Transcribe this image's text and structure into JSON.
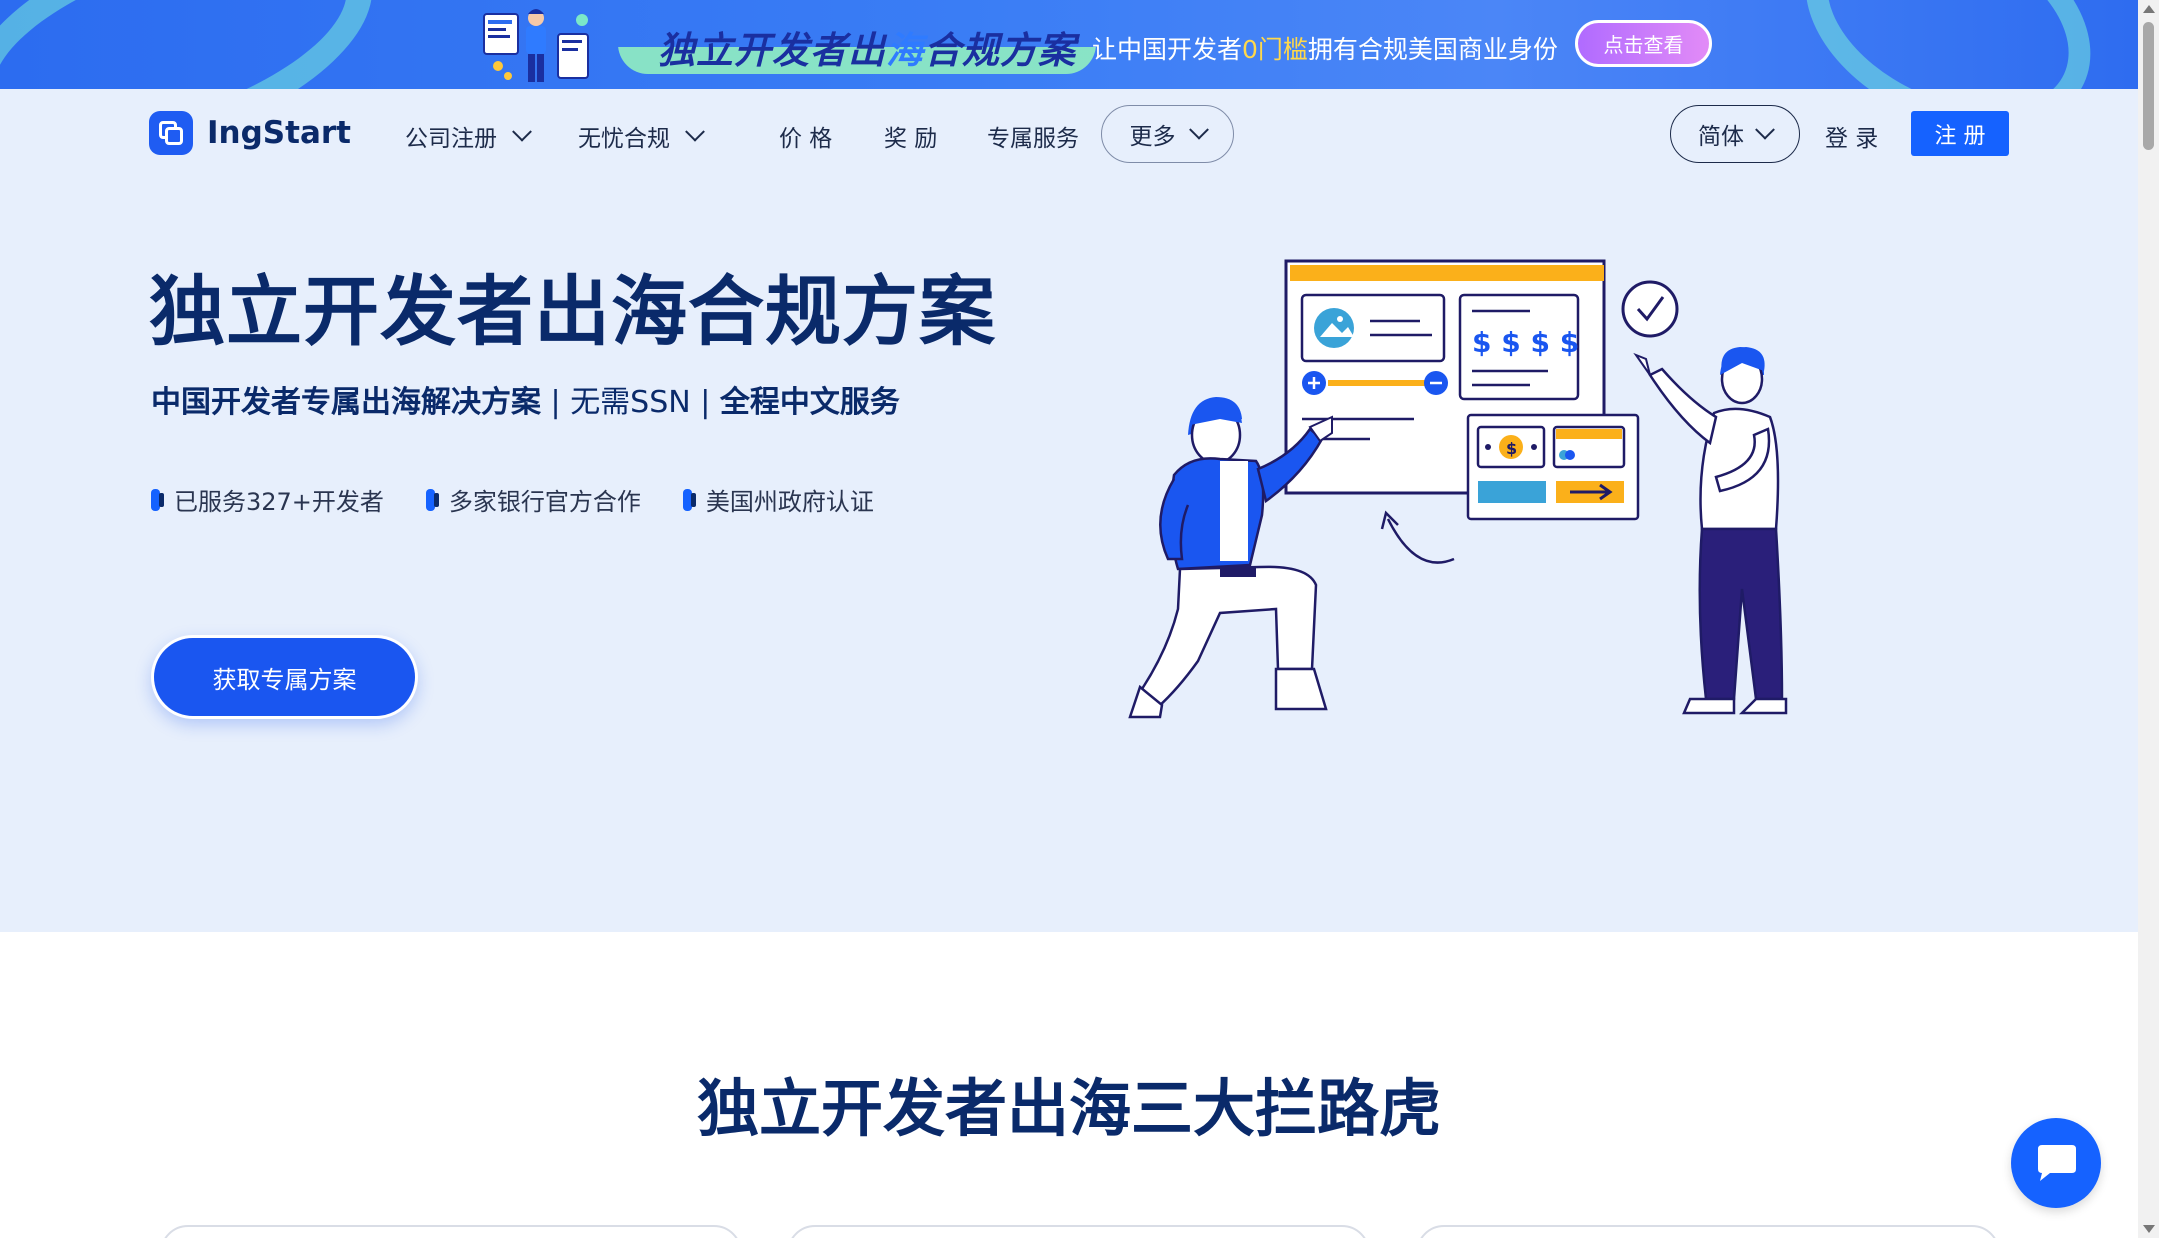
{
  "promo": {
    "title_a": "独立开发者出",
    "title_b": "海",
    "title_c": "合规方案",
    "subtitle_a": "让中国开发者",
    "subtitle_b": "0门槛",
    "subtitle_c": "拥有合规美国商业身份",
    "cta_label": "点击查看"
  },
  "nav": {
    "logo_text": "IngStart",
    "items": [
      {
        "label": "公司注册"
      },
      {
        "label": "无忧合规"
      },
      {
        "label": "价 格"
      },
      {
        "label": "奖 励"
      },
      {
        "label": "专属服务"
      }
    ],
    "more_label": "更多",
    "lang_label": "简体",
    "login_label": "登 录",
    "register_label": "注 册"
  },
  "hero": {
    "title": "独立开发者出海合规方案",
    "subtitle_a": "中国开发者专属出海解决方案",
    "separator": " | ",
    "subtitle_b": "无需SSN",
    "subtitle_c": "全程中文服务",
    "features": [
      {
        "label": "已服务327+开发者"
      },
      {
        "label": "多家银行官方合作"
      },
      {
        "label": "美国州政府认证"
      }
    ],
    "cta_label": "获取专属方案",
    "illustration_text": "$ $ $ $"
  },
  "section2": {
    "title": "独立开发者出海三大拦路虎"
  },
  "colors": {
    "brand": "#1562ff",
    "hero_bg": "#e7effc",
    "navy": "#0a2a6a"
  },
  "icons": [
    "chevron-down-icon",
    "chat-icon",
    "logo-icon",
    "check-circle-icon"
  ]
}
